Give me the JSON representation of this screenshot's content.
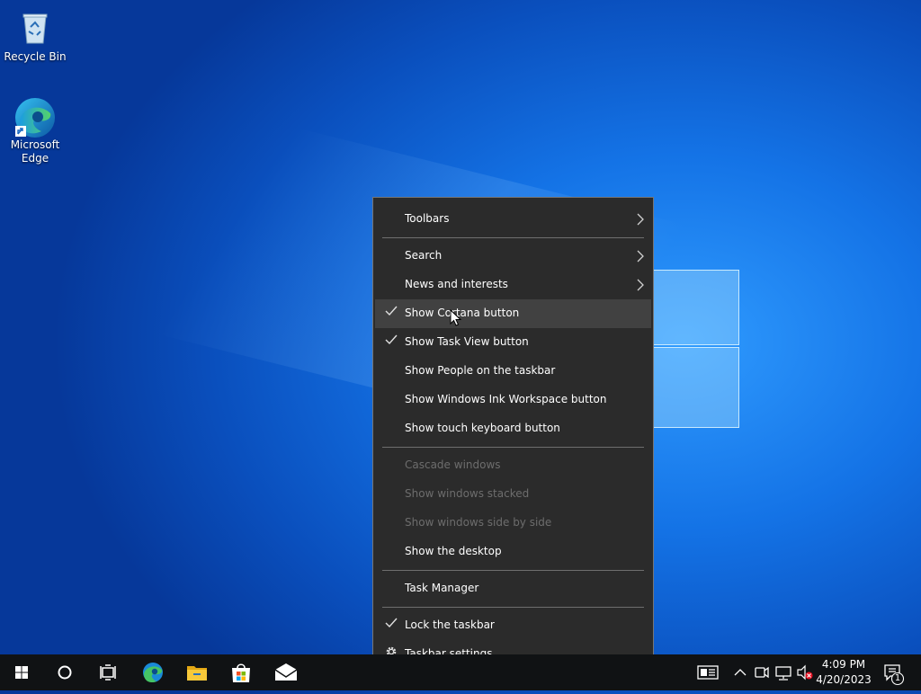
{
  "desktop": {
    "icons": [
      {
        "label": "Recycle Bin",
        "icon": "recycle-bin-icon"
      },
      {
        "label": "Microsoft Edge",
        "icon": "edge-icon"
      }
    ]
  },
  "context_menu": {
    "items": [
      {
        "label": "Toolbars",
        "submenu": true
      },
      {
        "label": "Search",
        "submenu": true
      },
      {
        "label": "News and interests",
        "submenu": true
      },
      {
        "label": "Show Cortana button",
        "checked": true,
        "hovered": true
      },
      {
        "label": "Show Task View button",
        "checked": true
      },
      {
        "label": "Show People on the taskbar"
      },
      {
        "label": "Show Windows Ink Workspace button"
      },
      {
        "label": "Show touch keyboard button"
      },
      {
        "label": "Cascade windows",
        "disabled": true
      },
      {
        "label": "Show windows stacked",
        "disabled": true
      },
      {
        "label": "Show windows side by side",
        "disabled": true
      },
      {
        "label": "Show the desktop"
      },
      {
        "label": "Task Manager"
      },
      {
        "label": "Lock the taskbar",
        "checked": true
      },
      {
        "label": "Taskbar settings",
        "icon": "gear-icon"
      }
    ]
  },
  "taskbar": {
    "pinned": [
      "start-icon",
      "cortana-icon",
      "task-view-icon",
      "edge-icon",
      "file-explorer-icon",
      "store-icon",
      "mail-icon"
    ],
    "tray": [
      "news-icon",
      "chevron-up-icon",
      "meet-now-icon",
      "network-icon",
      "volume-muted-icon"
    ],
    "clock": {
      "time": "4:09 PM",
      "date": "4/20/2023"
    },
    "notifications": {
      "count": "1"
    }
  },
  "colors": {
    "menu_bg": "#2b2b2b",
    "menu_hover": "#414141",
    "taskbar_bg": "#101214",
    "accent": "#0a5ed6"
  }
}
